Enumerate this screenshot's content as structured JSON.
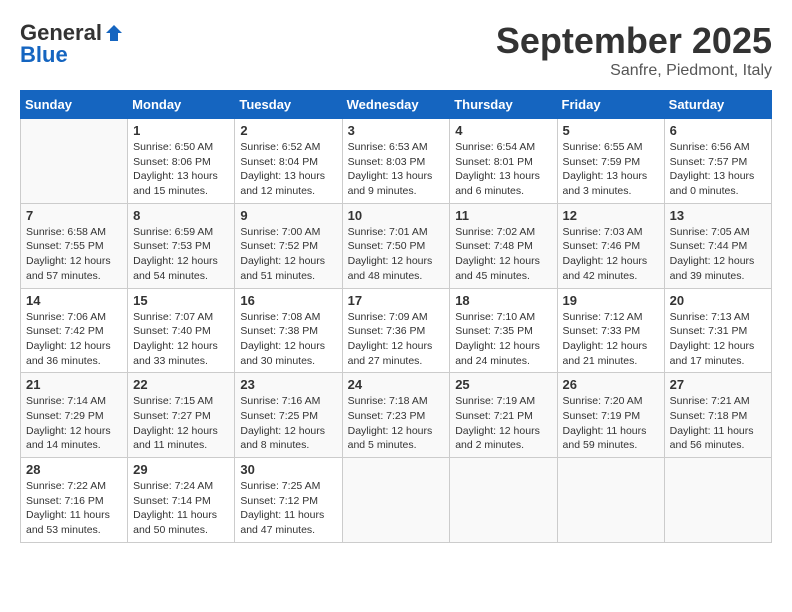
{
  "header": {
    "logo_general": "General",
    "logo_blue": "Blue",
    "month": "September 2025",
    "location": "Sanfre, Piedmont, Italy"
  },
  "weekdays": [
    "Sunday",
    "Monday",
    "Tuesday",
    "Wednesday",
    "Thursday",
    "Friday",
    "Saturday"
  ],
  "weeks": [
    [
      {
        "day": "",
        "info": ""
      },
      {
        "day": "1",
        "info": "Sunrise: 6:50 AM\nSunset: 8:06 PM\nDaylight: 13 hours\nand 15 minutes."
      },
      {
        "day": "2",
        "info": "Sunrise: 6:52 AM\nSunset: 8:04 PM\nDaylight: 13 hours\nand 12 minutes."
      },
      {
        "day": "3",
        "info": "Sunrise: 6:53 AM\nSunset: 8:03 PM\nDaylight: 13 hours\nand 9 minutes."
      },
      {
        "day": "4",
        "info": "Sunrise: 6:54 AM\nSunset: 8:01 PM\nDaylight: 13 hours\nand 6 minutes."
      },
      {
        "day": "5",
        "info": "Sunrise: 6:55 AM\nSunset: 7:59 PM\nDaylight: 13 hours\nand 3 minutes."
      },
      {
        "day": "6",
        "info": "Sunrise: 6:56 AM\nSunset: 7:57 PM\nDaylight: 13 hours\nand 0 minutes."
      }
    ],
    [
      {
        "day": "7",
        "info": "Sunrise: 6:58 AM\nSunset: 7:55 PM\nDaylight: 12 hours\nand 57 minutes."
      },
      {
        "day": "8",
        "info": "Sunrise: 6:59 AM\nSunset: 7:53 PM\nDaylight: 12 hours\nand 54 minutes."
      },
      {
        "day": "9",
        "info": "Sunrise: 7:00 AM\nSunset: 7:52 PM\nDaylight: 12 hours\nand 51 minutes."
      },
      {
        "day": "10",
        "info": "Sunrise: 7:01 AM\nSunset: 7:50 PM\nDaylight: 12 hours\nand 48 minutes."
      },
      {
        "day": "11",
        "info": "Sunrise: 7:02 AM\nSunset: 7:48 PM\nDaylight: 12 hours\nand 45 minutes."
      },
      {
        "day": "12",
        "info": "Sunrise: 7:03 AM\nSunset: 7:46 PM\nDaylight: 12 hours\nand 42 minutes."
      },
      {
        "day": "13",
        "info": "Sunrise: 7:05 AM\nSunset: 7:44 PM\nDaylight: 12 hours\nand 39 minutes."
      }
    ],
    [
      {
        "day": "14",
        "info": "Sunrise: 7:06 AM\nSunset: 7:42 PM\nDaylight: 12 hours\nand 36 minutes."
      },
      {
        "day": "15",
        "info": "Sunrise: 7:07 AM\nSunset: 7:40 PM\nDaylight: 12 hours\nand 33 minutes."
      },
      {
        "day": "16",
        "info": "Sunrise: 7:08 AM\nSunset: 7:38 PM\nDaylight: 12 hours\nand 30 minutes."
      },
      {
        "day": "17",
        "info": "Sunrise: 7:09 AM\nSunset: 7:36 PM\nDaylight: 12 hours\nand 27 minutes."
      },
      {
        "day": "18",
        "info": "Sunrise: 7:10 AM\nSunset: 7:35 PM\nDaylight: 12 hours\nand 24 minutes."
      },
      {
        "day": "19",
        "info": "Sunrise: 7:12 AM\nSunset: 7:33 PM\nDaylight: 12 hours\nand 21 minutes."
      },
      {
        "day": "20",
        "info": "Sunrise: 7:13 AM\nSunset: 7:31 PM\nDaylight: 12 hours\nand 17 minutes."
      }
    ],
    [
      {
        "day": "21",
        "info": "Sunrise: 7:14 AM\nSunset: 7:29 PM\nDaylight: 12 hours\nand 14 minutes."
      },
      {
        "day": "22",
        "info": "Sunrise: 7:15 AM\nSunset: 7:27 PM\nDaylight: 12 hours\nand 11 minutes."
      },
      {
        "day": "23",
        "info": "Sunrise: 7:16 AM\nSunset: 7:25 PM\nDaylight: 12 hours\nand 8 minutes."
      },
      {
        "day": "24",
        "info": "Sunrise: 7:18 AM\nSunset: 7:23 PM\nDaylight: 12 hours\nand 5 minutes."
      },
      {
        "day": "25",
        "info": "Sunrise: 7:19 AM\nSunset: 7:21 PM\nDaylight: 12 hours\nand 2 minutes."
      },
      {
        "day": "26",
        "info": "Sunrise: 7:20 AM\nSunset: 7:19 PM\nDaylight: 11 hours\nand 59 minutes."
      },
      {
        "day": "27",
        "info": "Sunrise: 7:21 AM\nSunset: 7:18 PM\nDaylight: 11 hours\nand 56 minutes."
      }
    ],
    [
      {
        "day": "28",
        "info": "Sunrise: 7:22 AM\nSunset: 7:16 PM\nDaylight: 11 hours\nand 53 minutes."
      },
      {
        "day": "29",
        "info": "Sunrise: 7:24 AM\nSunset: 7:14 PM\nDaylight: 11 hours\nand 50 minutes."
      },
      {
        "day": "30",
        "info": "Sunrise: 7:25 AM\nSunset: 7:12 PM\nDaylight: 11 hours\nand 47 minutes."
      },
      {
        "day": "",
        "info": ""
      },
      {
        "day": "",
        "info": ""
      },
      {
        "day": "",
        "info": ""
      },
      {
        "day": "",
        "info": ""
      }
    ]
  ]
}
